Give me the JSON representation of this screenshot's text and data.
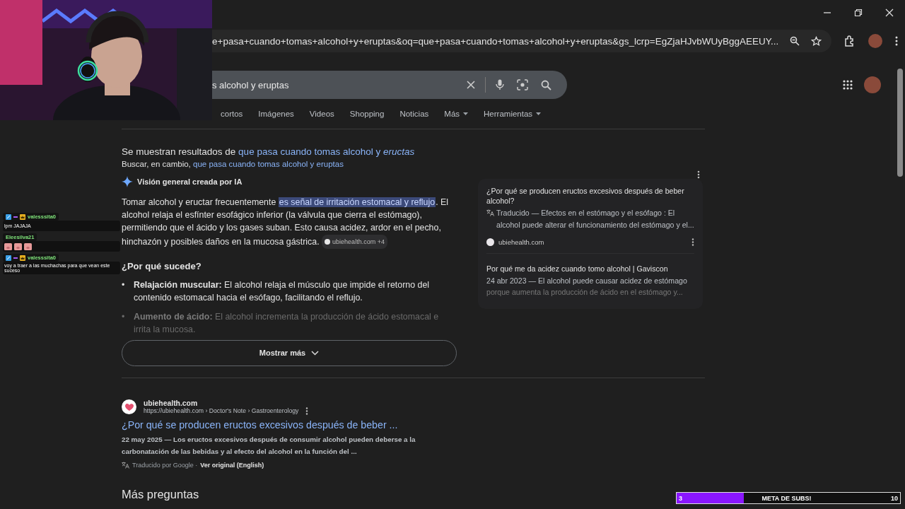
{
  "browser": {
    "url": "e+pasa+cuando+tomas+alcohol+y+eruptas&oq=que+pasa+cuando+tomas+alcohol+y+eruptas&gs_lcrp=EgZjaHJvbWUyBggAEEUY..."
  },
  "search": {
    "query": "s alcohol y eruptas"
  },
  "tabs": [
    {
      "label": "cortos",
      "selected": false,
      "kind": "tab"
    },
    {
      "label": "Imágenes",
      "selected": false,
      "kind": "tab"
    },
    {
      "label": "Videos",
      "selected": false,
      "kind": "tab"
    },
    {
      "label": "Shopping",
      "selected": false,
      "kind": "tab"
    },
    {
      "label": "Noticias",
      "selected": false,
      "kind": "tab"
    },
    {
      "label": "Más",
      "selected": false,
      "kind": "dropdown"
    },
    {
      "label": "Herramientas",
      "selected": false,
      "kind": "dropdown"
    }
  ],
  "correction": {
    "shown_prefix": "Se muestran resultados de",
    "shown_link": "que pasa cuando tomas alcohol y *eructas*",
    "instead_prefix": "Buscar, en cambio,",
    "instead_link": "que pasa cuando tomas alcohol y eruptas"
  },
  "ai_overview": {
    "title": "Visión general creada por IA",
    "lead": "Tomar alcohol y eructar frecuentemente",
    "highlight": "es señal de irritación estomacal y reflujo",
    "rest": ". El alcohol relaja el esfínter esofágico inferior (la válvula que cierra el estómago), permitiendo que el ácido y los gases suban. Esto causa acidez, ardor en el pecho, hinchazón y posibles daños en la mucosa gástrica.",
    "source_chip": "ubiehealth.com +4",
    "heading": "¿Por qué sucede?",
    "bullets": [
      {
        "marker": "•",
        "term": "Relajación muscular:",
        "text": "El alcohol relaja el músculo que impide el retorno del contenido estomacal hacia el esófago, facilitando el reflujo.",
        "faded": false
      },
      {
        "marker": "•",
        "term": "Aumento de ácido:",
        "text": "El alcohol incrementa la producción de ácido estomacal e irrita la mucosa.",
        "faded": true
      }
    ],
    "show_more": "Mostrar más",
    "sources": [
      {
        "title": "¿Por qué se producen eructos excesivos después de beber alcohol?",
        "snippet": "Traducido — Efectos en el estómago y el esófago : El alcohol puede alterar el funcionamiento del estómago y el...",
        "translated": true,
        "site": "ubiehealth.com"
      },
      {
        "title": "Por qué me da acidez cuando tomo alcohol | Gaviscon",
        "snippet": "24 abr 2023 — El alcohol puede causar acidez de estómago",
        "snippet_faded": "porque aumenta la producción de ácido en el estómago y...",
        "translated": false
      }
    ]
  },
  "result": {
    "site": "ubiehealth.com",
    "url": "https://ubiehealth.com › Doctor's Note › Gastroenterology",
    "title": "¿Por qué se producen eructos excesivos después de beber ...",
    "snippet": "22 may 2025 — Los eructos excesivos después de consumir alcohol pueden deberse a la carbonatación de las bebidas y al efecto del alcohol en la función del ...",
    "translated_by": "Traducido por Google ·",
    "original_link": "Ver original (English)"
  },
  "more_questions": "Más preguntas",
  "chat": [
    {
      "user": "valesssita0",
      "badges": true,
      "text": "lpm JAJAJA"
    },
    {
      "user": "Eleesilva21",
      "badges": false,
      "emotes": [
        {
          "kind": "pig"
        },
        {
          "kind": "pig"
        },
        {
          "kind": "pig"
        }
      ]
    },
    {
      "user": "valesssita0",
      "badges": true,
      "text": "voy a traer a las muchachas para que vean este suceso"
    }
  ],
  "sub_goal": {
    "current": "3",
    "label": "META DE SUBS!",
    "target": "10",
    "level": 0.3
  }
}
